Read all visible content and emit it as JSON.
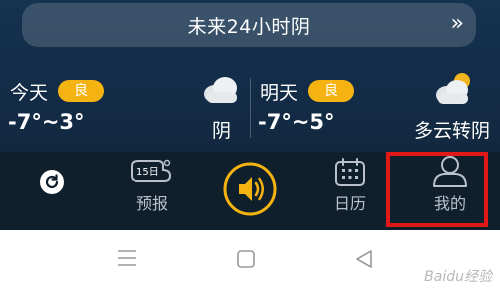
{
  "forecast": {
    "title": "未来24小时阴",
    "arrow": "»"
  },
  "today": {
    "label": "今天",
    "aqi": "良",
    "temp": "-7°~3°",
    "condition": "阴",
    "icon": "cloudy-icon"
  },
  "tomorrow": {
    "label": "明天",
    "aqi": "良",
    "temp": "-7°~5°",
    "condition": "多云转阴",
    "icon": "partly-cloudy-icon"
  },
  "tabs": [
    {
      "label": "",
      "icon": "refresh-icon"
    },
    {
      "label": "预报",
      "icon": "15-day-forecast-icon",
      "icon_text": "15日"
    },
    {
      "label": "",
      "icon": "speaker-icon"
    },
    {
      "label": "日历",
      "icon": "calendar-icon"
    },
    {
      "label": "我的",
      "icon": "profile-icon"
    }
  ],
  "colors": {
    "accent": "#f5b311",
    "highlight": "#e01818",
    "panel": "#15324f",
    "tabbar": "#0f1f2c"
  },
  "system_nav": [
    "menu-icon",
    "home-icon",
    "back-icon"
  ],
  "watermark": "Baidu经验"
}
